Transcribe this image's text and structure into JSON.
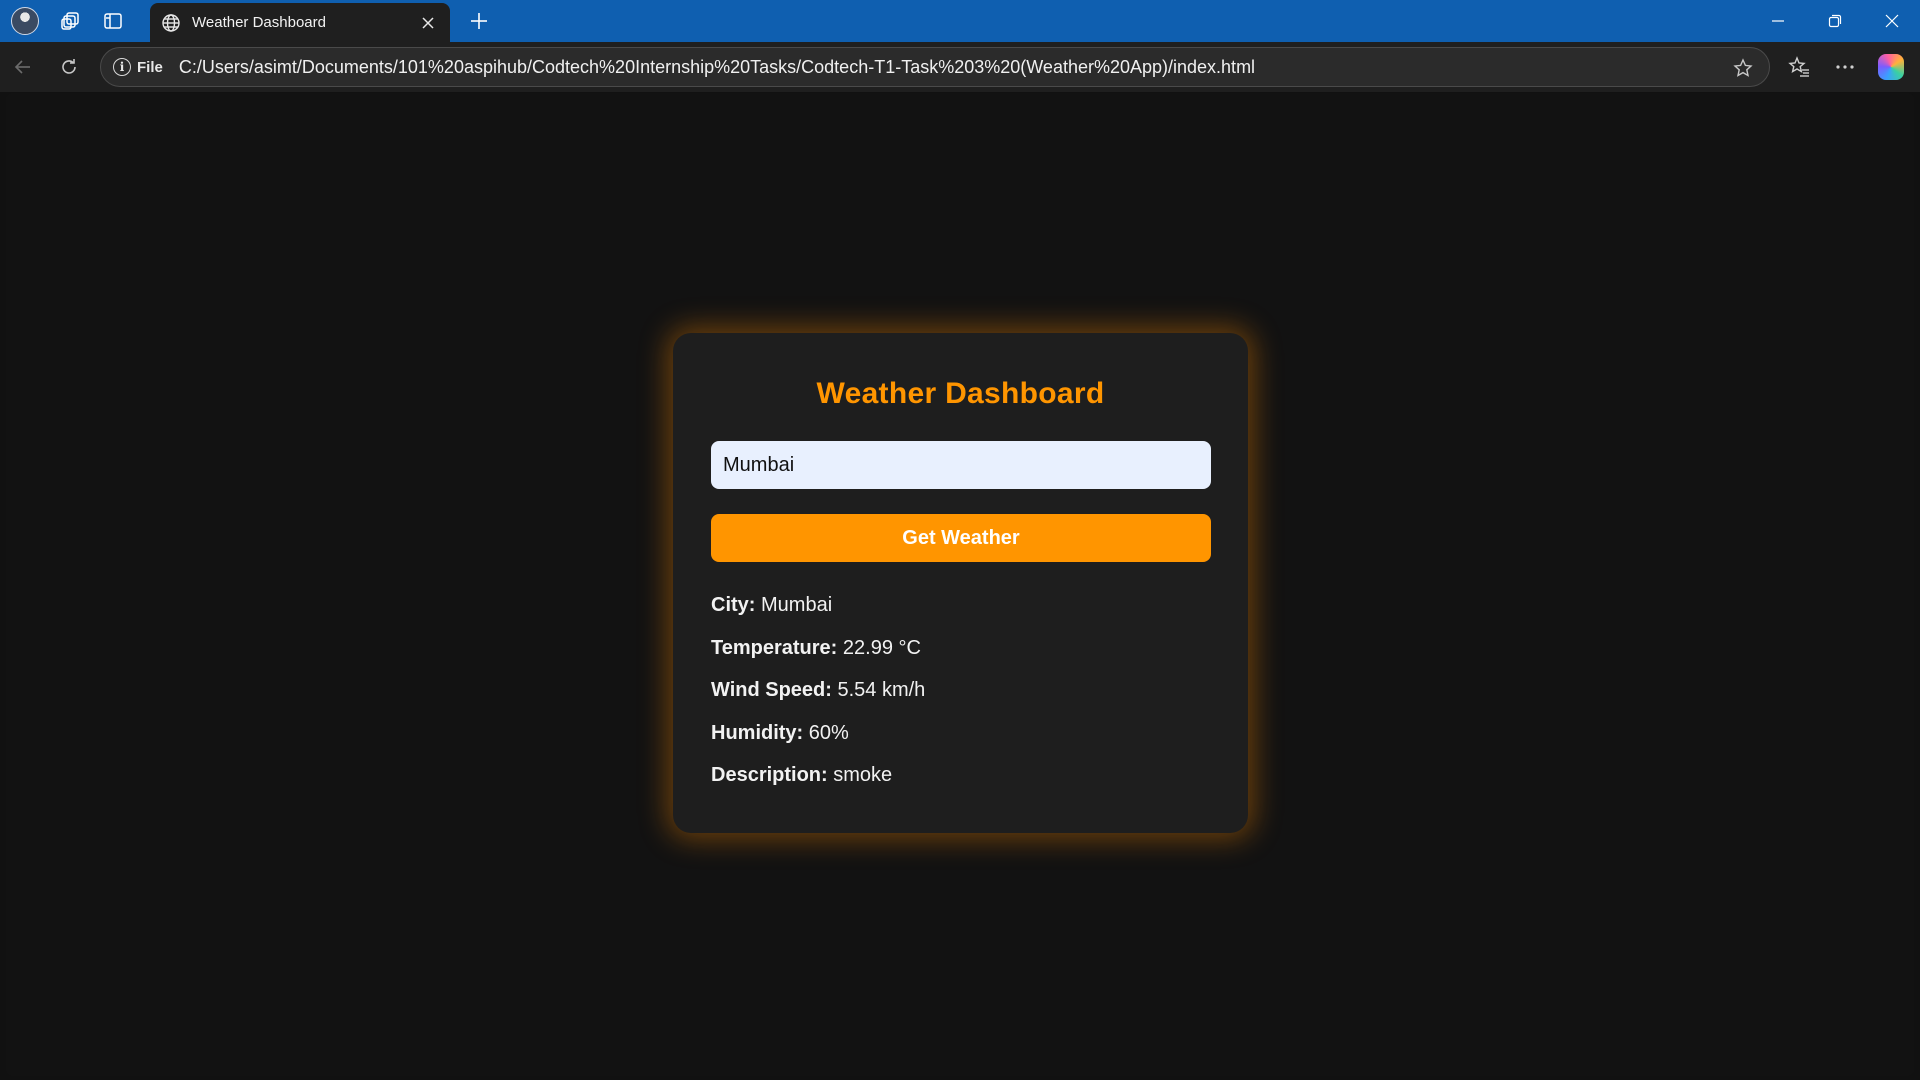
{
  "browser": {
    "tab_title": "Weather Dashboard",
    "site_info_label": "File",
    "url": "C:/Users/asimt/Documents/101%20aspihub/Codtech%20Internship%20Tasks/Codtech-T1-Task%203%20(Weather%20App)/index.html"
  },
  "app": {
    "title": "Weather Dashboard",
    "city_input_value": "Mumbai",
    "button_label": "Get Weather",
    "accent_color": "#ff9500"
  },
  "weather": {
    "city_label": "City:",
    "city_value": "Mumbai",
    "temperature_label": "Temperature:",
    "temperature_value": "22.99 °C",
    "wind_label": "Wind Speed:",
    "wind_value": "5.54 km/h",
    "humidity_label": "Humidity:",
    "humidity_value": "60%",
    "description_label": "Description:",
    "description_value": "smoke"
  },
  "icons": [
    "avatar",
    "workspaces-icon",
    "vertical-tabs-icon",
    "globe-icon",
    "close-icon",
    "plus-icon",
    "minimize-icon",
    "restore-icon",
    "back-icon",
    "refresh-icon",
    "info-icon",
    "star-icon",
    "favorites-icon",
    "more-icon",
    "copilot-icon"
  ]
}
